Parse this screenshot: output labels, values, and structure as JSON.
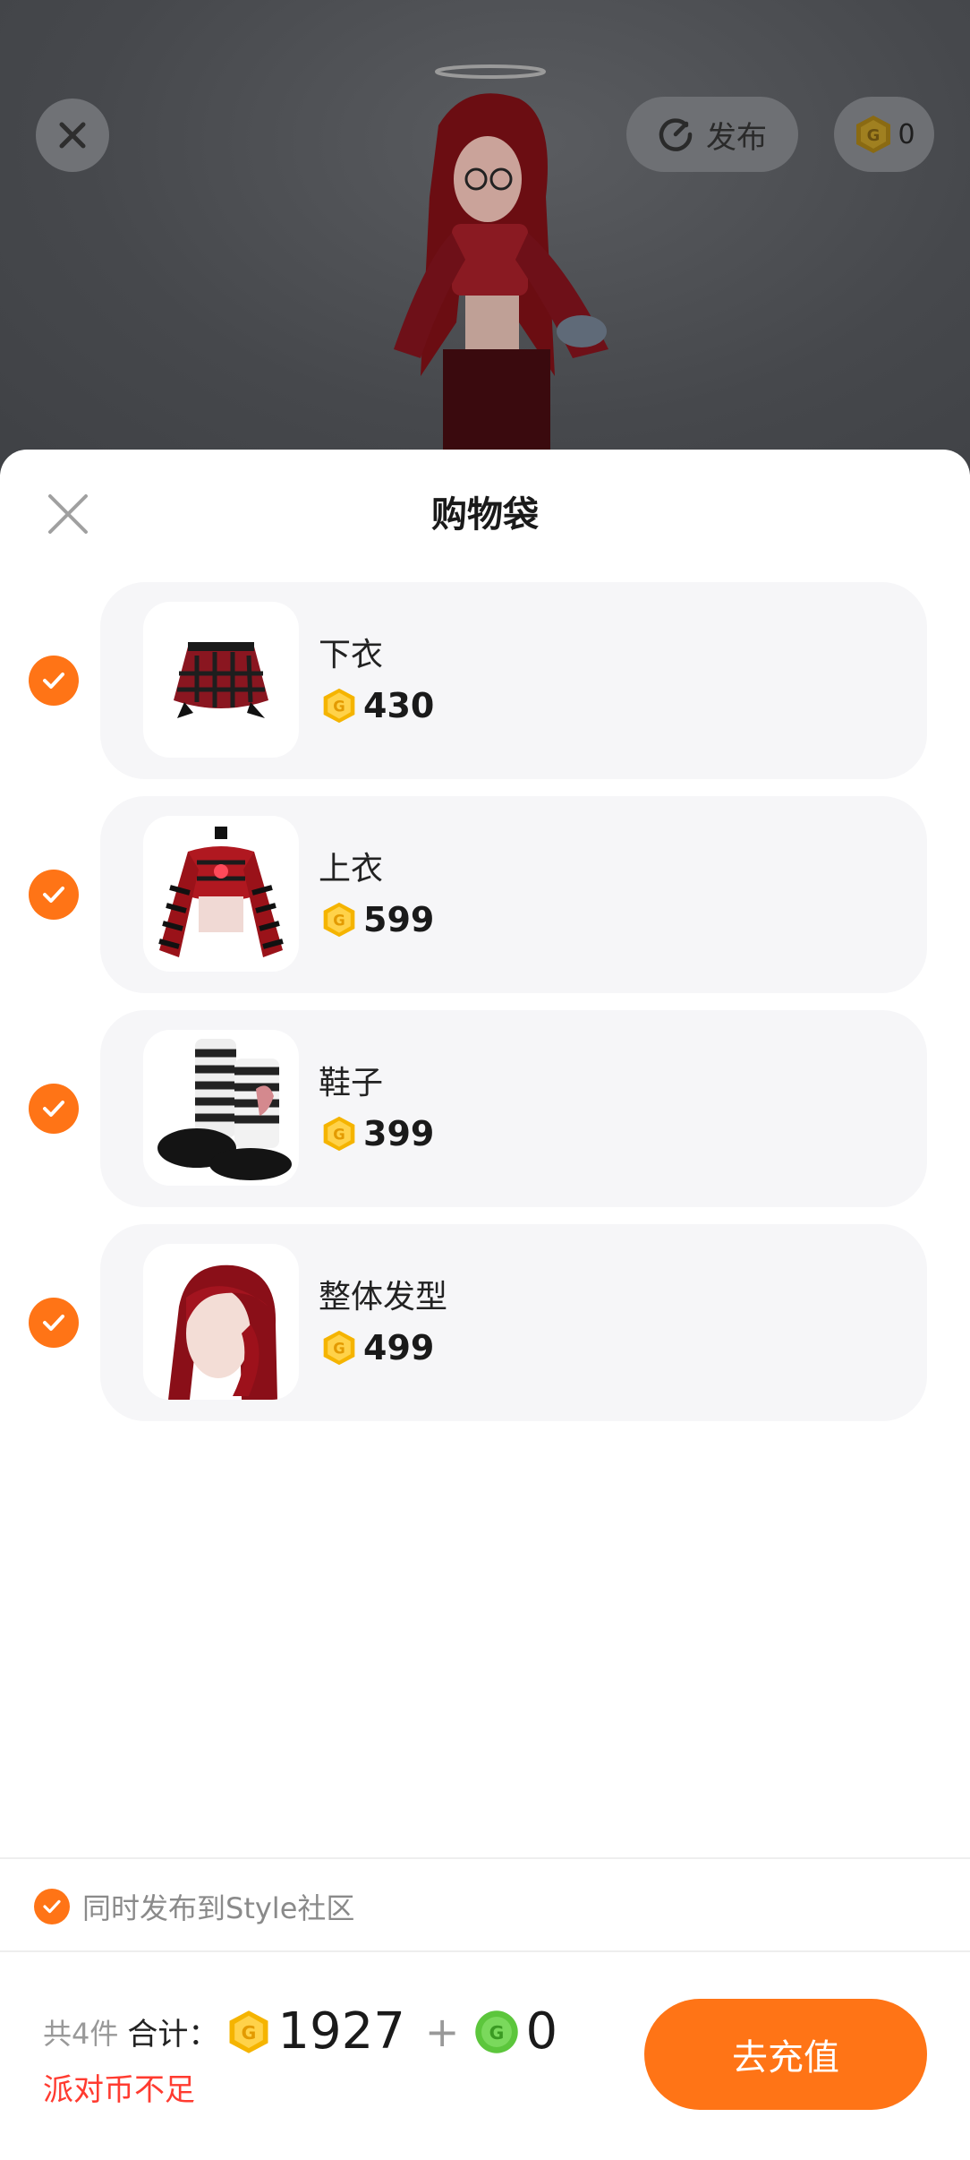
{
  "top_bar": {
    "publish_label": "发布",
    "coin_count": "0"
  },
  "sheet": {
    "title": "购物袋"
  },
  "items": [
    {
      "name": "下衣",
      "price": "430",
      "checked": true,
      "thumb": "skirt"
    },
    {
      "name": "上衣",
      "price": "599",
      "checked": true,
      "thumb": "striped-top"
    },
    {
      "name": "鞋子",
      "price": "399",
      "checked": true,
      "thumb": "boots"
    },
    {
      "name": "整体发型",
      "price": "499",
      "checked": true,
      "thumb": "red-hair"
    }
  ],
  "community": {
    "label": "同时发布到Style社区",
    "checked": true
  },
  "footer": {
    "count_text": "共4件",
    "sum_label": "合计：",
    "gold_total": "1927",
    "plus": "+",
    "green_total": "0",
    "warning": "派对币不足",
    "recharge_label": "去充值"
  },
  "colors": {
    "accent": "#ff7416",
    "warning": "#ff3b30",
    "gold_coin": "#f5b400",
    "green_coin": "#5cc63c"
  },
  "icons": {
    "close": "close-icon",
    "publish": "refresh-arrow-icon",
    "coin": "gold-coin-icon",
    "green_coin": "green-coin-icon",
    "check": "check-icon"
  }
}
